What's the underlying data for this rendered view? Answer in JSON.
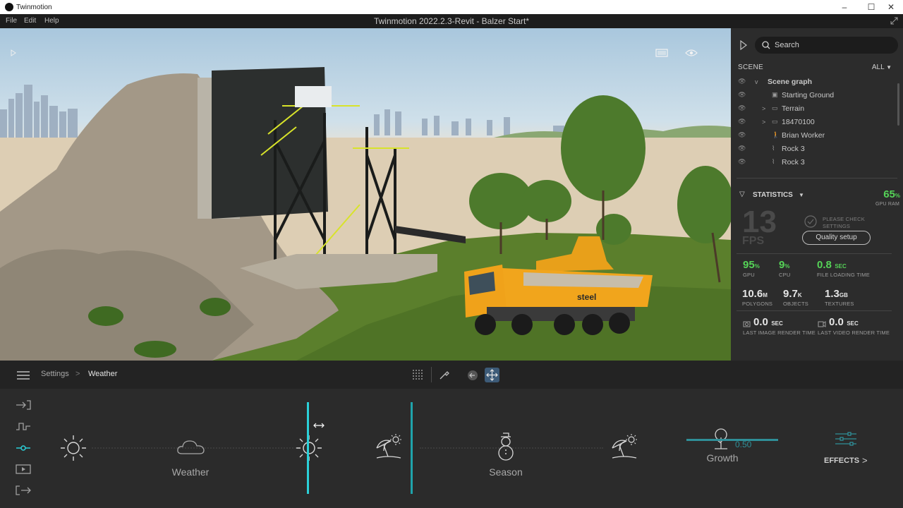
{
  "app": {
    "name": "Twinmotion",
    "doc_title": "Twinmotion 2022.2.3-Revit - Balzer Start*"
  },
  "window_controls": {
    "minimize": "–",
    "maximize": "☐",
    "close": "✕"
  },
  "menu": [
    "File",
    "Edit",
    "Help"
  ],
  "search": {
    "placeholder": "Search"
  },
  "scene": {
    "title": "SCENE",
    "filter": "ALL",
    "tree": [
      {
        "label": "Scene graph",
        "prefix": "v",
        "icon": ""
      },
      {
        "label": "Starting Ground",
        "prefix": "",
        "icon": "cube-icon"
      },
      {
        "label": "Terrain",
        "prefix": ">",
        "icon": "folder-icon"
      },
      {
        "label": "18470100",
        "prefix": ">",
        "icon": "folder-icon"
      },
      {
        "label": "Brian Worker",
        "prefix": "",
        "icon": "person-icon"
      },
      {
        "label": "Rock 3",
        "prefix": "",
        "icon": "rock-icon"
      },
      {
        "label": "Rock 3",
        "prefix": "",
        "icon": "rock-icon"
      }
    ]
  },
  "statistics": {
    "title": "STATISTICS",
    "gpu_ram": {
      "value": "65",
      "unit": "%",
      "label": "GPU RAM"
    },
    "fps": {
      "value": "13",
      "label": "FPS"
    },
    "check_text": "PLEASE CHECK SETTINGS",
    "quality_button": "Quality setup",
    "gpu": {
      "value": "95",
      "unit": "%",
      "label": "GPU"
    },
    "cpu": {
      "value": "9",
      "unit": "%",
      "label": "CPU"
    },
    "file_loading": {
      "value": "0.8",
      "unit": "SEC",
      "label": "FILE LOADING TIME"
    },
    "polygons": {
      "value": "10.6",
      "unit": "M",
      "label": "POLYGONS"
    },
    "objects": {
      "value": "9.7",
      "unit": "K",
      "label": "OBJECTS"
    },
    "textures": {
      "value": "1.3",
      "unit": "GB",
      "label": "TEXTURES"
    },
    "last_image": {
      "value": "0.0",
      "unit": "SEC",
      "label": "LAST IMAGE RENDER TIME"
    },
    "last_video": {
      "value": "0.0",
      "unit": "SEC",
      "label": "LAST VIDEO RENDER TIME"
    }
  },
  "breadcrumb": {
    "root": "Settings",
    "separator": ">",
    "current": "Weather"
  },
  "weather_panel": {
    "weather_label": "Weather",
    "season_label": "Season",
    "growth_label": "Growth",
    "growth_value": "0.50",
    "effects_label": "EFFECTS",
    "effects_chevron": ">"
  },
  "colors": {
    "accent_cyan": "#2bd0d8",
    "stat_green": "#55d357",
    "panel_bg": "#2b2b2b"
  },
  "truck_text": "steel"
}
